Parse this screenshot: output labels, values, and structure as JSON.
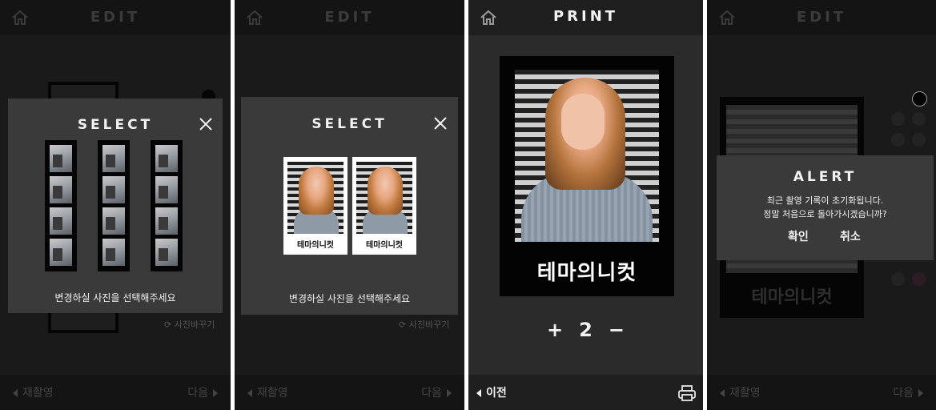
{
  "screen1": {
    "header_title": "EDIT",
    "modal_title": "SELECT",
    "modal_message": "변경하실 사진을 선택해주세요",
    "behind_link": "사진바꾸기",
    "footer_left": "재촬영",
    "footer_right": "다음"
  },
  "screen2": {
    "header_title": "EDIT",
    "modal_title": "SELECT",
    "modal_message": "변경하실 사진을 선택해주세요",
    "behind_link": "사진바꾸기",
    "polaroid_logo": "테마의니컷",
    "footer_left": "재촬영",
    "footer_right": "다음"
  },
  "screen3": {
    "header_title": "PRINT",
    "frame_logo": "테마의니컷",
    "quantity": "2",
    "plus": "+",
    "minus": "−",
    "footer_left": "이전",
    "print_icon": "printer-icon"
  },
  "screen4": {
    "header_title": "EDIT",
    "alert_title": "ALERT",
    "alert_line1": "최근 촬영 기록이 초기화됩니다.",
    "alert_line2": "정말 처음으로 돌아가시겠습니까?",
    "confirm": "확인",
    "cancel": "취소",
    "frame_logo": "테마의니컷",
    "footer_left": "재촬영",
    "footer_right": "다음"
  },
  "icons": {
    "home": "home-icon",
    "close": "close-icon",
    "refresh": "refresh-icon"
  },
  "colors": {
    "background": "#1a1a1a",
    "modal": "#3a3a3a",
    "text": "#f0f0f0"
  }
}
